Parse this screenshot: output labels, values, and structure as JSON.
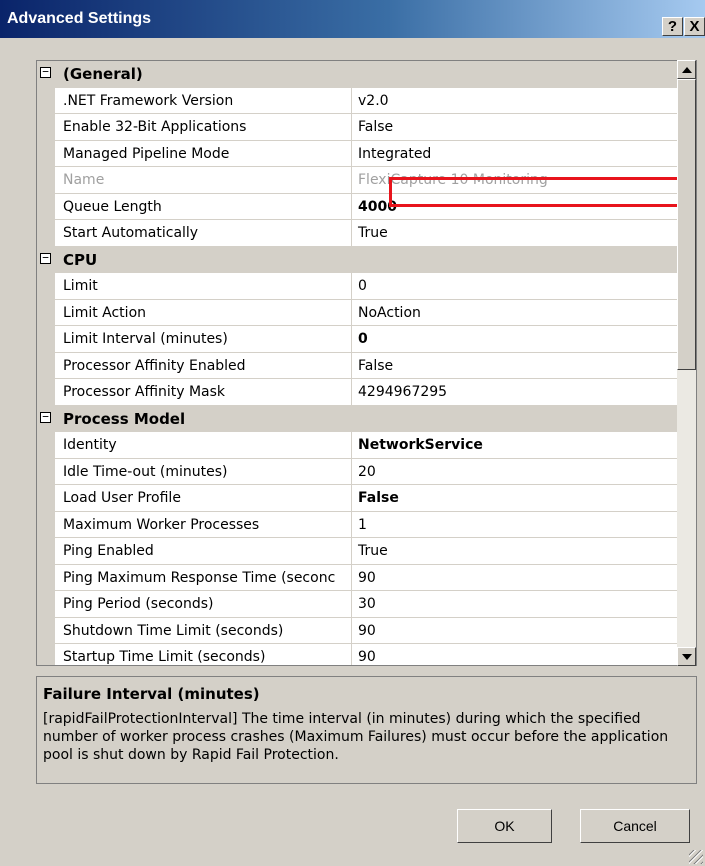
{
  "window": {
    "title": "Advanced Settings",
    "help_label": "?",
    "close_label": "X"
  },
  "grid": {
    "rows": [
      {
        "type": "category",
        "name": "(General)",
        "expander": "−"
      },
      {
        "type": "prop",
        "name": ".NET Framework Version",
        "value": "v2.0",
        "bold": false,
        "dim": false
      },
      {
        "type": "prop",
        "name": "Enable 32-Bit Applications",
        "value": "False",
        "bold": false,
        "dim": false,
        "highlighted": true
      },
      {
        "type": "prop",
        "name": "Managed Pipeline Mode",
        "value": "Integrated",
        "bold": false,
        "dim": false
      },
      {
        "type": "prop",
        "name": "Name",
        "value": "FlexiCapture 10 Monitoring",
        "bold": false,
        "dim": true
      },
      {
        "type": "prop",
        "name": "Queue Length",
        "value": "4000",
        "bold": true,
        "dim": false
      },
      {
        "type": "prop",
        "name": "Start Automatically",
        "value": "True",
        "bold": false,
        "dim": false
      },
      {
        "type": "category",
        "name": "CPU",
        "expander": "−"
      },
      {
        "type": "prop",
        "name": "Limit",
        "value": "0",
        "bold": false,
        "dim": false
      },
      {
        "type": "prop",
        "name": "Limit Action",
        "value": "NoAction",
        "bold": false,
        "dim": false
      },
      {
        "type": "prop",
        "name": "Limit Interval (minutes)",
        "value": "0",
        "bold": true,
        "dim": false
      },
      {
        "type": "prop",
        "name": "Processor Affinity Enabled",
        "value": "False",
        "bold": false,
        "dim": false
      },
      {
        "type": "prop",
        "name": "Processor Affinity Mask",
        "value": "4294967295",
        "bold": false,
        "dim": false
      },
      {
        "type": "category",
        "name": "Process Model",
        "expander": "−"
      },
      {
        "type": "prop",
        "name": "Identity",
        "value": "NetworkService",
        "bold": true,
        "dim": false
      },
      {
        "type": "prop",
        "name": "Idle Time-out (minutes)",
        "value": "20",
        "bold": false,
        "dim": false
      },
      {
        "type": "prop",
        "name": "Load User Profile",
        "value": "False",
        "bold": true,
        "dim": false
      },
      {
        "type": "prop",
        "name": "Maximum Worker Processes",
        "value": "1",
        "bold": false,
        "dim": false
      },
      {
        "type": "prop",
        "name": "Ping Enabled",
        "value": "True",
        "bold": false,
        "dim": false
      },
      {
        "type": "prop",
        "name": "Ping Maximum Response Time (seconc",
        "value": "90",
        "bold": false,
        "dim": false
      },
      {
        "type": "prop",
        "name": "Ping Period (seconds)",
        "value": "30",
        "bold": false,
        "dim": false
      },
      {
        "type": "prop",
        "name": "Shutdown Time Limit (seconds)",
        "value": "90",
        "bold": false,
        "dim": false
      },
      {
        "type": "prop",
        "name": "Startup Time Limit (seconds)",
        "value": "90",
        "bold": false,
        "dim": false
      }
    ],
    "highlight_color": "#e8141c"
  },
  "description": {
    "title": "Failure Interval (minutes)",
    "text": "[rapidFailProtectionInterval] The time interval (in minutes) during which the specified number of worker process crashes (Maximum Failures) must occur before the application pool is shut down by Rapid Fail Protection."
  },
  "buttons": {
    "ok": "OK",
    "cancel": "Cancel"
  }
}
